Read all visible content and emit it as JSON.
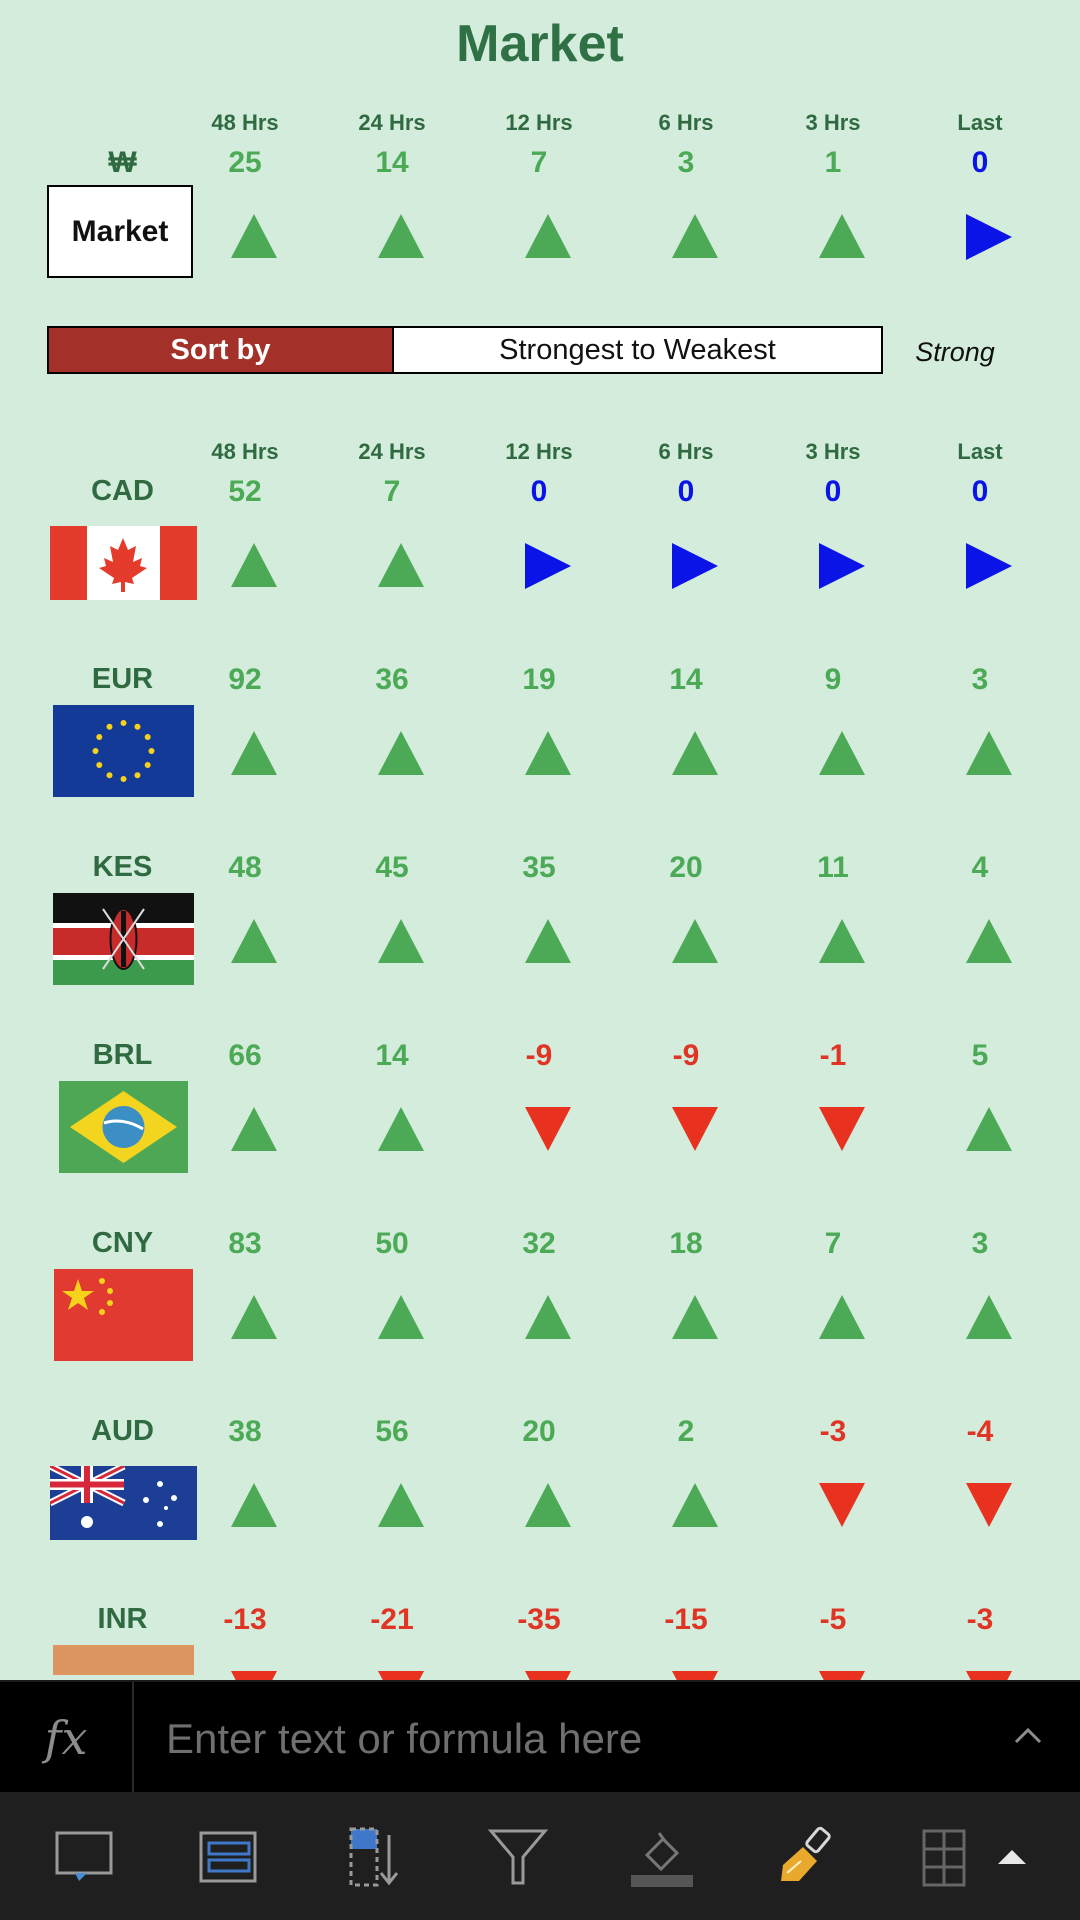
{
  "title": "Market",
  "summary": {
    "symbol": "₩",
    "button_label": "Market",
    "headers": [
      "48 Hrs",
      "24 Hrs",
      "12 Hrs",
      "6 Hrs",
      "3 Hrs",
      "Last"
    ],
    "values": [
      "25",
      "14",
      "7",
      "3",
      "1",
      "0"
    ],
    "trends": [
      "up",
      "up",
      "up",
      "up",
      "up",
      "flat"
    ]
  },
  "sort": {
    "label": "Sort by",
    "value": "Strongest to Weakest",
    "strength": "Strong"
  },
  "table_headers": [
    "48 Hrs",
    "24 Hrs",
    "12 Hrs",
    "6 Hrs",
    "3 Hrs",
    "Last"
  ],
  "currencies": [
    {
      "code": "CAD",
      "flag": "canada-flag",
      "values": [
        "52",
        "7",
        "0",
        "0",
        "0",
        "0"
      ],
      "trends": [
        "up",
        "up",
        "flat",
        "flat",
        "flat",
        "flat"
      ]
    },
    {
      "code": "EUR",
      "flag": "eu-flag",
      "values": [
        "92",
        "36",
        "19",
        "14",
        "9",
        "3"
      ],
      "trends": [
        "up",
        "up",
        "up",
        "up",
        "up",
        "up"
      ]
    },
    {
      "code": "KES",
      "flag": "kenya-flag",
      "values": [
        "48",
        "45",
        "35",
        "20",
        "11",
        "4"
      ],
      "trends": [
        "up",
        "up",
        "up",
        "up",
        "up",
        "up"
      ]
    },
    {
      "code": "BRL",
      "flag": "brazil-flag",
      "values": [
        "66",
        "14",
        "-9",
        "-9",
        "-1",
        "5"
      ],
      "trends": [
        "up",
        "up",
        "down",
        "down",
        "down",
        "up"
      ]
    },
    {
      "code": "CNY",
      "flag": "china-flag",
      "values": [
        "83",
        "50",
        "32",
        "18",
        "7",
        "3"
      ],
      "trends": [
        "up",
        "up",
        "up",
        "up",
        "up",
        "up"
      ]
    },
    {
      "code": "AUD",
      "flag": "australia-flag",
      "values": [
        "38",
        "56",
        "20",
        "2",
        "-3",
        "-4"
      ],
      "trends": [
        "up",
        "up",
        "up",
        "up",
        "down",
        "down"
      ]
    },
    {
      "code": "INR",
      "flag": "india-flag",
      "values": [
        "-13",
        "-21",
        "-35",
        "-15",
        "-5",
        "-3"
      ],
      "trends": [
        "down",
        "down",
        "down",
        "down",
        "down",
        "down"
      ]
    }
  ],
  "formula_bar": {
    "fx_label": "fx",
    "placeholder": "Enter text or formula here"
  },
  "toolbar": {
    "icons": [
      "display-icon",
      "layout-icon",
      "sort-icon",
      "filter-icon",
      "fill-icon",
      "clear-format-icon",
      "table-icon",
      "expand-up-icon"
    ]
  },
  "colors": {
    "background": "#d3ecdc",
    "up": "#4caa57",
    "down": "#e03424",
    "flat": "#0a14e6",
    "title": "#2f7044",
    "sort_bar": "#a4302a"
  }
}
